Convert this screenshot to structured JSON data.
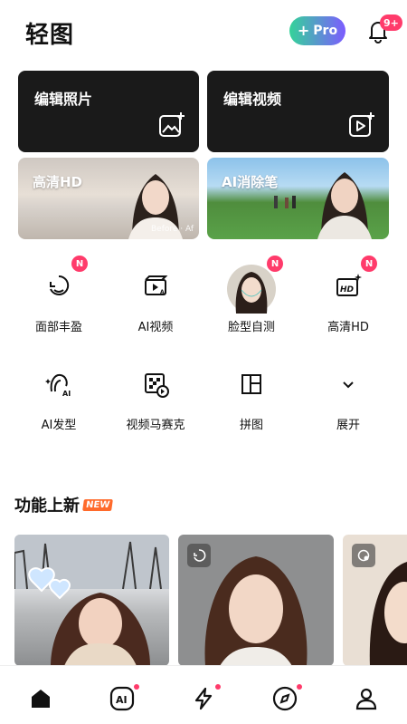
{
  "app": {
    "logo": "轻图"
  },
  "header": {
    "pro_label": "Pro",
    "notification_count": "9+"
  },
  "edit_cards": [
    {
      "title": "编辑照片",
      "icon": "image-plus-icon"
    },
    {
      "title": "编辑视频",
      "icon": "video-plus-icon"
    }
  ],
  "photo_cards": [
    {
      "title": "高清HD",
      "caption": "Before · Af"
    },
    {
      "title": "AI消除笔"
    }
  ],
  "tools": [
    {
      "label": "面部丰盈",
      "icon": "face-contour-icon",
      "badge": "N"
    },
    {
      "label": "AI视频",
      "icon": "ai-video-icon"
    },
    {
      "label": "脸型自测",
      "icon": "face-avatar-icon",
      "badge": "N"
    },
    {
      "label": "高清HD",
      "icon": "hd-sparkle-icon",
      "badge": "N"
    },
    {
      "label": "AI发型",
      "icon": "ai-hair-icon"
    },
    {
      "label": "视频马赛克",
      "icon": "mosaic-video-icon"
    },
    {
      "label": "拼图",
      "icon": "collage-icon"
    },
    {
      "label": "展开",
      "icon": "chevron-down-icon"
    }
  ],
  "section": {
    "title": "功能上新",
    "new_tag": "NEW"
  },
  "feed": [
    {
      "icon": ""
    },
    {
      "icon": "face-contour-icon"
    },
    {
      "icon": "face-scan-icon"
    }
  ],
  "tabbar": [
    {
      "name": "home-icon",
      "active": true
    },
    {
      "name": "ai-icon",
      "dot": true
    },
    {
      "name": "lightning-icon",
      "dot": true
    },
    {
      "name": "compass-icon",
      "dot": true
    },
    {
      "name": "profile-icon"
    }
  ],
  "colors": {
    "accent": "#ff3b6b",
    "pro_gradient_start": "#34d399",
    "pro_gradient_end": "#7c5cff",
    "dark_card": "#1a1a1a"
  }
}
